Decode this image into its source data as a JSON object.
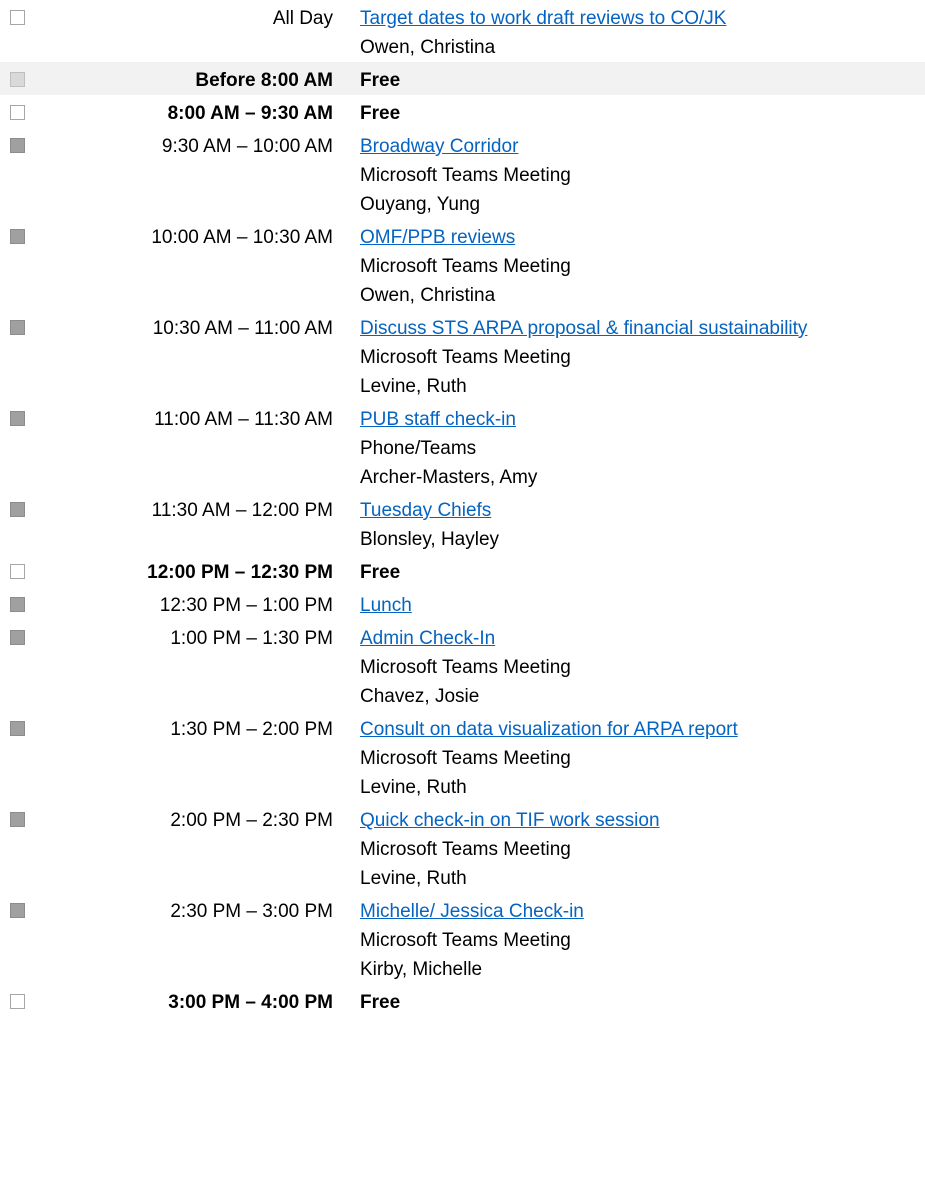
{
  "agenda": [
    {
      "time": "All Day",
      "time_bold": false,
      "status": "free",
      "shaded": false,
      "title": "Target dates to work draft reviews to CO/JK",
      "is_link": true,
      "lines": [
        "Owen, Christina"
      ]
    },
    {
      "time": "Before 8:00 AM",
      "time_bold": true,
      "status": "free",
      "shaded": true,
      "title": "Free",
      "is_link": false,
      "lines": []
    },
    {
      "time": "8:00 AM – 9:30 AM",
      "time_bold": true,
      "status": "free",
      "shaded": false,
      "title": "Free",
      "is_link": false,
      "lines": []
    },
    {
      "time": "9:30 AM – 10:00 AM",
      "time_bold": false,
      "status": "busy",
      "shaded": false,
      "title": "Broadway Corridor",
      "is_link": true,
      "lines": [
        "Microsoft Teams Meeting",
        "Ouyang, Yung"
      ]
    },
    {
      "time": "10:00 AM – 10:30 AM",
      "time_bold": false,
      "status": "busy",
      "shaded": false,
      "title": "OMF/PPB reviews",
      "is_link": true,
      "lines": [
        "Microsoft Teams Meeting",
        "Owen, Christina"
      ]
    },
    {
      "time": "10:30 AM – 11:00 AM",
      "time_bold": false,
      "status": "busy",
      "shaded": false,
      "title": "Discuss STS ARPA proposal & financial sustainability",
      "is_link": true,
      "lines": [
        "Microsoft Teams Meeting",
        "Levine, Ruth"
      ]
    },
    {
      "time": "11:00 AM – 11:30 AM",
      "time_bold": false,
      "status": "busy",
      "shaded": false,
      "title": "PUB staff check-in",
      "is_link": true,
      "lines": [
        "Phone/Teams",
        "Archer-Masters, Amy"
      ]
    },
    {
      "time": "11:30 AM – 12:00 PM",
      "time_bold": false,
      "status": "busy",
      "shaded": false,
      "title": "Tuesday Chiefs",
      "is_link": true,
      "lines": [
        "Blonsley, Hayley"
      ]
    },
    {
      "time": "12:00 PM – 12:30 PM",
      "time_bold": true,
      "status": "free",
      "shaded": false,
      "title": "Free",
      "is_link": false,
      "lines": []
    },
    {
      "time": "12:30 PM – 1:00 PM",
      "time_bold": false,
      "status": "busy",
      "shaded": false,
      "title": "Lunch",
      "is_link": true,
      "lines": []
    },
    {
      "time": "1:00 PM – 1:30 PM",
      "time_bold": false,
      "status": "busy",
      "shaded": false,
      "title": "Admin Check-In",
      "is_link": true,
      "lines": [
        "Microsoft Teams Meeting",
        "Chavez, Josie"
      ]
    },
    {
      "time": "1:30 PM – 2:00 PM",
      "time_bold": false,
      "status": "busy",
      "shaded": false,
      "title": "Consult on data visualization for ARPA report",
      "is_link": true,
      "lines": [
        "Microsoft Teams Meeting",
        "Levine, Ruth"
      ]
    },
    {
      "time": "2:00 PM – 2:30 PM",
      "time_bold": false,
      "status": "busy",
      "shaded": false,
      "title": "Quick check-in on TIF work session",
      "is_link": true,
      "lines": [
        "Microsoft Teams Meeting",
        "Levine, Ruth"
      ]
    },
    {
      "time": "2:30 PM – 3:00 PM",
      "time_bold": false,
      "status": "busy",
      "shaded": false,
      "title": "Michelle/ Jessica Check-in",
      "is_link": true,
      "lines": [
        "Microsoft Teams Meeting",
        "Kirby, Michelle"
      ]
    },
    {
      "time": "3:00 PM – 4:00 PM",
      "time_bold": true,
      "status": "free",
      "shaded": false,
      "title": "Free",
      "is_link": false,
      "lines": []
    }
  ]
}
